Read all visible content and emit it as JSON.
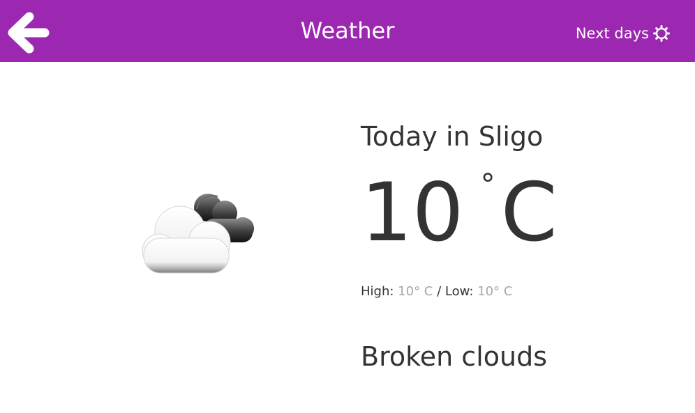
{
  "header": {
    "title": "Weather",
    "back_icon": "arrow-left-icon",
    "next_days_label": "Next days",
    "next_days_icon": "gear-icon",
    "color": "#9c27b0"
  },
  "current": {
    "heading": "Today in Sligo",
    "temperature": "10",
    "degree": "°",
    "unit": "C",
    "high_label": "High:",
    "high_value": "10° C",
    "separator": "/",
    "low_label": "Low:",
    "low_value": "10° C",
    "condition": "Broken clouds",
    "icon": "broken-clouds-icon"
  }
}
